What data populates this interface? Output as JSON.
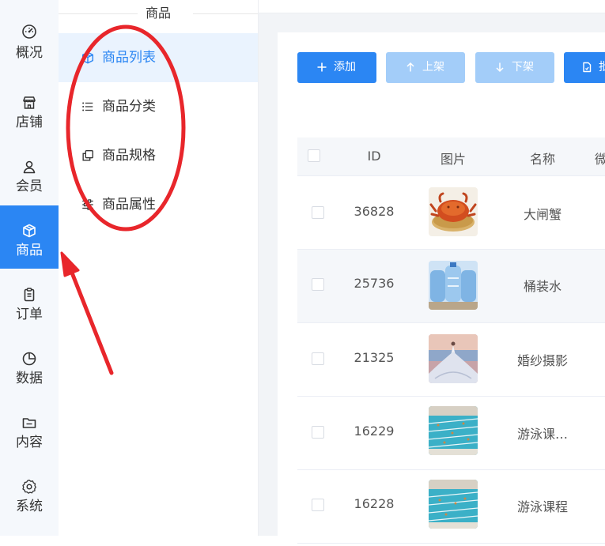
{
  "nav": {
    "items": [
      {
        "label": "概况",
        "icon": "dashboard-icon"
      },
      {
        "label": "店铺",
        "icon": "store-icon"
      },
      {
        "label": "会员",
        "icon": "user-icon"
      },
      {
        "label": "商品",
        "icon": "box-icon",
        "active": true
      },
      {
        "label": "订单",
        "icon": "clipboard-icon"
      },
      {
        "label": "数据",
        "icon": "pie-chart-icon"
      },
      {
        "label": "内容",
        "icon": "folder-icon"
      },
      {
        "label": "系统",
        "icon": "gear-icon"
      }
    ]
  },
  "submenu": {
    "title": "商品",
    "items": [
      {
        "label": "商品列表",
        "icon": "box-icon",
        "active": true
      },
      {
        "label": "商品分类",
        "icon": "list-icon"
      },
      {
        "label": "商品规格",
        "icon": "copy-icon"
      },
      {
        "label": "商品属性",
        "icon": "sliders-icon"
      }
    ]
  },
  "toolbar": {
    "add_label": "添加",
    "up_label": "上架",
    "down_label": "下架",
    "batch_label": "批"
  },
  "table": {
    "columns": {
      "id": "ID",
      "image": "图片",
      "name": "名称",
      "more": "微"
    },
    "rows": [
      {
        "id": "36828",
        "name": "大闸蟹",
        "image": "crab"
      },
      {
        "id": "25736",
        "name": "桶装水",
        "image": "water-bottles"
      },
      {
        "id": "21325",
        "name": "婚纱摄影",
        "image": "wedding-photo"
      },
      {
        "id": "16229",
        "name": "游泳课…",
        "image": "swimming-pool"
      },
      {
        "id": "16228",
        "name": "游泳课程",
        "image": "swimming-pool"
      }
    ]
  },
  "colors": {
    "accent": "#2b86f3",
    "accent_light": "#a3cdf9",
    "annotation": "#e8262b"
  }
}
